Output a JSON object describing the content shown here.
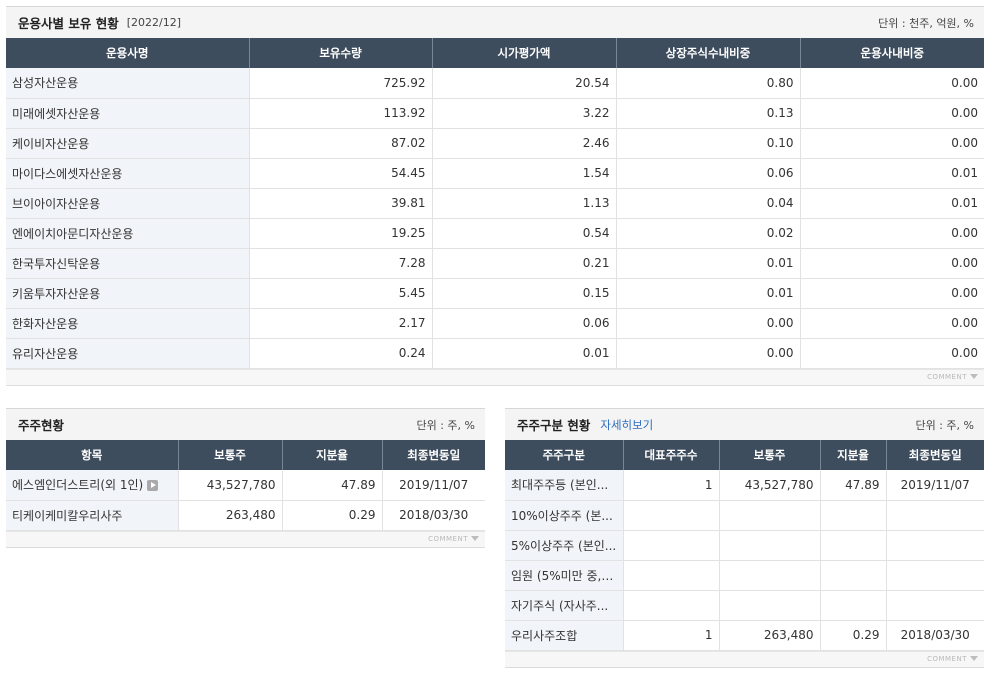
{
  "fund_section": {
    "title": "운용사별 보유 현황",
    "date": "[2022/12]",
    "unit": "단위 : 천주, 억원, %",
    "columns": [
      "운용사명",
      "보유수량",
      "시가평가액",
      "상장주식수내비중",
      "운용사내비중"
    ],
    "rows": [
      [
        "삼성자산운용",
        "725.92",
        "20.54",
        "0.80",
        "0.00"
      ],
      [
        "미래에셋자산운용",
        "113.92",
        "3.22",
        "0.13",
        "0.00"
      ],
      [
        "케이비자산운용",
        "87.02",
        "2.46",
        "0.10",
        "0.00"
      ],
      [
        "마이다스에셋자산운용",
        "54.45",
        "1.54",
        "0.06",
        "0.01"
      ],
      [
        "브이아이자산운용",
        "39.81",
        "1.13",
        "0.04",
        "0.01"
      ],
      [
        "엔에이치아문디자산운용",
        "19.25",
        "0.54",
        "0.02",
        "0.00"
      ],
      [
        "한국투자신탁운용",
        "7.28",
        "0.21",
        "0.01",
        "0.00"
      ],
      [
        "키움투자자산운용",
        "5.45",
        "0.15",
        "0.01",
        "0.00"
      ],
      [
        "한화자산운용",
        "2.17",
        "0.06",
        "0.00",
        "0.00"
      ],
      [
        "유리자산운용",
        "0.24",
        "0.01",
        "0.00",
        "0.00"
      ]
    ],
    "comment_label": "COMMENT"
  },
  "shareholder_section": {
    "title": "주주현황",
    "unit": "단위 : 주, %",
    "columns": [
      "항목",
      "보통주",
      "지분율",
      "최종변동일"
    ],
    "rows": [
      [
        "에스엠인더스트리(외 1인)",
        "43,527,780",
        "47.89",
        "2019/11/07"
      ],
      [
        "티케이케미칼우리사주",
        "263,480",
        "0.29",
        "2018/03/30"
      ]
    ],
    "comment_label": "COMMENT"
  },
  "category_section": {
    "title": "주주구분 현황",
    "more_link": "자세히보기",
    "unit": "단위 : 주, %",
    "columns": [
      "주주구분",
      "대표주주수",
      "보통주",
      "지분율",
      "최종변동일"
    ],
    "rows": [
      [
        "최대주주등 (본인...",
        "1",
        "43,527,780",
        "47.89",
        "2019/11/07"
      ],
      [
        "10%이상주주 (본...",
        "",
        "",
        "",
        ""
      ],
      [
        "5%이상주주 (본인...",
        "",
        "",
        "",
        ""
      ],
      [
        "임원 (5%미만 중, ...",
        "",
        "",
        "",
        ""
      ],
      [
        "자기주식 (자사주...",
        "",
        "",
        "",
        ""
      ],
      [
        "우리사주조합",
        "1",
        "263,480",
        "0.29",
        "2018/03/30"
      ]
    ],
    "comment_label": "COMMENT"
  }
}
